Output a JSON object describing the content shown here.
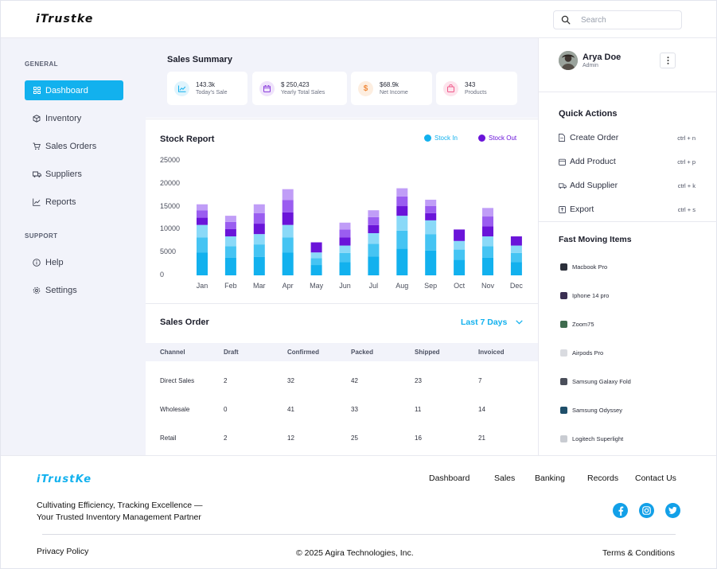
{
  "header": {
    "logo": "iTrustke",
    "search_placeholder": "Search"
  },
  "sidebar": {
    "general_label": "GENERAL",
    "support_label": "SUPPORT",
    "items": [
      {
        "label": "Dashboard",
        "icon": "grid-icon",
        "active": true
      },
      {
        "label": "Inventory",
        "icon": "box-icon"
      },
      {
        "label": "Sales Orders",
        "icon": "cart-icon"
      },
      {
        "label": "Suppliers",
        "icon": "truck-icon"
      },
      {
        "label": "Reports",
        "icon": "chart-line-icon"
      }
    ],
    "support_items": [
      {
        "label": "Help",
        "icon": "info-icon"
      },
      {
        "label": "Settings",
        "icon": "gear-icon"
      }
    ]
  },
  "summary": {
    "title": "Sales Summary",
    "cards": [
      {
        "value": "143.3k",
        "label": "Today's Sale",
        "icon": "trend-icon",
        "color": "#12b1ee"
      },
      {
        "value": "$ 250,423",
        "label": "Yearly Total Sales",
        "icon": "calendar-icon",
        "color": "#8b3fdc"
      },
      {
        "value": "$68.9k",
        "label": "Net Income",
        "icon": "dollar-icon",
        "color": "#f08a3c"
      },
      {
        "value": "343",
        "label": "Products",
        "icon": "bag-icon",
        "color": "#f05a8a"
      }
    ]
  },
  "stock": {
    "title": "Stock Report",
    "legend_in": "Stock In",
    "legend_out": "Stock Out",
    "colors": {
      "in": "#12b1ee",
      "out": "#6a14d9"
    }
  },
  "chart_data": {
    "type": "bar",
    "stacked": true,
    "title": "Stock Report",
    "categories": [
      "Jan",
      "Feb",
      "Mar",
      "Apr",
      "May",
      "Jun",
      "Jul",
      "Aug",
      "Sep",
      "Oct",
      "Nov",
      "Dec"
    ],
    "y_ticks": [
      0,
      5000,
      10000,
      15000,
      20000,
      25000
    ],
    "ylim": [
      0,
      25000
    ],
    "series": [
      {
        "name": "Stock In",
        "values": [
          11000,
          8500,
          9000,
          11000,
          5000,
          6500,
          9200,
          13000,
          12000,
          7500,
          8500,
          6500
        ]
      },
      {
        "name": "Stock Out",
        "values": [
          4500,
          4500,
          6500,
          7800,
          2200,
          5000,
          5000,
          6000,
          4500,
          2500,
          6200,
          2000
        ]
      }
    ],
    "legend": "top-right",
    "grid": false
  },
  "sales": {
    "title": "Sales Order",
    "filter": "Last 7 Days",
    "columns": [
      "Channel",
      "Draft",
      "Confirmed",
      "Packed",
      "Shipped",
      "Invoiced"
    ],
    "rows": [
      [
        "Direct Sales",
        "2",
        "32",
        "42",
        "23",
        "7"
      ],
      [
        "Wholesale",
        "0",
        "41",
        "33",
        "11",
        "14"
      ],
      [
        "Retail",
        "2",
        "12",
        "25",
        "16",
        "21"
      ]
    ]
  },
  "profile": {
    "name": "Arya Doe",
    "role": "Admin"
  },
  "quick_actions": {
    "title": "Quick Actions",
    "items": [
      {
        "label": "Create Order",
        "shortcut": "ctrl + n",
        "icon": "file-icon"
      },
      {
        "label": "Add Product",
        "shortcut": "ctrl + p",
        "icon": "calendar-icon"
      },
      {
        "label": "Add Supplier",
        "shortcut": "ctrl + k",
        "icon": "truck-icon"
      },
      {
        "label": "Export",
        "shortcut": "ctrl + s",
        "icon": "export-icon"
      }
    ]
  },
  "fast_moving": {
    "title": "Fast Moving Items",
    "items": [
      "Macbook Pro",
      "Iphone 14 pro",
      "Zoom75",
      "Airpods Pro",
      "Samsung Galaxy Fold",
      "Samsung Odyssey",
      "Logitech Superlight"
    ]
  },
  "footer": {
    "logo": "iTrustKe",
    "links": [
      "Dashboard",
      "Sales",
      "Banking",
      "Records",
      "Contact Us"
    ],
    "tagline_1": "Cultivating Efficiency, Tracking Excellence —",
    "tagline_2": "Your Trusted Inventory Management Partner",
    "privacy": "Privacy Policy",
    "copyright": "© 2025 Agira Technologies, Inc.",
    "terms": "Terms & Conditions",
    "social": [
      "facebook-icon",
      "instagram-icon",
      "twitter-icon"
    ]
  }
}
